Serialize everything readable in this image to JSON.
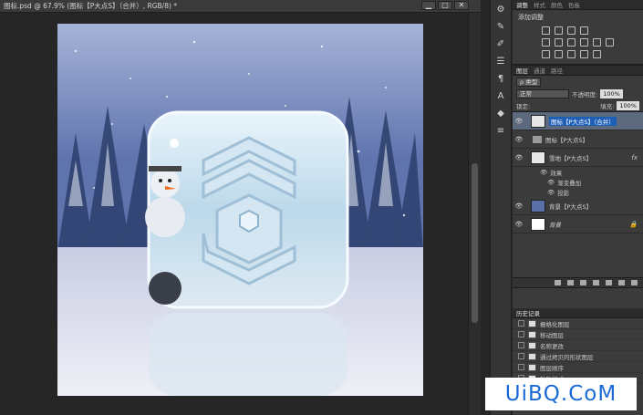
{
  "document": {
    "tab_title": "图标.psd @ 67.9% (图标【P大点S】（合并）, RGB/8) *"
  },
  "window_buttons": [
    "▁",
    "▢",
    "✕"
  ],
  "tools": [
    "gear-icon",
    "pen-icon",
    "brush-icon",
    "sliders-icon",
    "paragraph-icon",
    "text-icon",
    "cube-icon",
    "options-icon"
  ],
  "adjust_panel": {
    "tabs": [
      "调整",
      "样式",
      "颜色",
      "色板"
    ],
    "title": "添加调整"
  },
  "layers_panel": {
    "tabs": [
      "图层",
      "通道",
      "路径"
    ],
    "filter_kind": "ρ 类型",
    "blend_mode": "正常",
    "opacity_label": "不透明度:",
    "opacity_value": "100%",
    "lock_label": "锁定:",
    "fill_label": "填充:",
    "fill_value": "100%",
    "layers": [
      {
        "name": "图标【P大点S】（合并）",
        "selected": true
      },
      {
        "name": "图标【P大点S】",
        "folder": true
      },
      {
        "name": "雪地【P大点S】",
        "fx": "fx"
      },
      {
        "name": "背景【P大点S】"
      },
      {
        "name": "背景",
        "locked": true
      }
    ],
    "effects_label": "效果",
    "effects": [
      "渐变叠加",
      "投影"
    ]
  },
  "history_panel": {
    "title": "历史记录",
    "items": [
      "栅格化图层",
      "移动图层",
      "名称更改",
      "通过拷贝的形状图层",
      "图层顺序",
      "粘贴样式"
    ]
  },
  "watermark": "UiBQ.CoM"
}
